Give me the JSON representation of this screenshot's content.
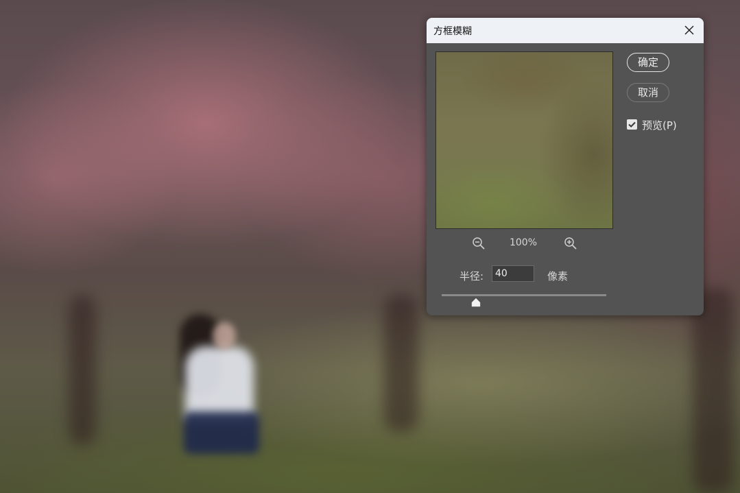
{
  "dialog": {
    "title": "方框模糊",
    "zoom_level": "100%",
    "radius_label": "半径:",
    "radius_value": "40",
    "unit_label": "像素",
    "slider_value": 40,
    "ok_label": "确定",
    "cancel_label": "取消",
    "preview_label": "预览(P)",
    "preview_checked": true
  },
  "icons": {
    "close": "close-icon",
    "zoom_out": "zoom-out-icon",
    "zoom_in": "zoom-in-icon",
    "checkbox": "checkmark-icon",
    "slider_thumb": "slider-thumb-icon"
  },
  "colors": {
    "dialog_bg": "#535353",
    "titlebar_bg": "#eef1f6",
    "text": "#d6d6d6"
  }
}
